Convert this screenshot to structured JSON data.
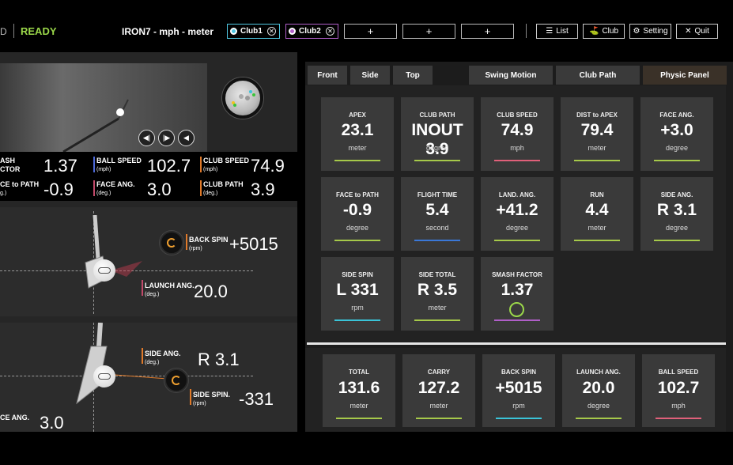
{
  "header": {
    "logo_fragment": "D",
    "status": "READY",
    "title": "IRON7 - mph - meter",
    "club_slots": [
      {
        "label": "Club1",
        "color": "#4ec6e0",
        "removable": true
      },
      {
        "label": "Club2",
        "color": "#b05fc9",
        "removable": true
      },
      {
        "label": "+"
      },
      {
        "label": "+"
      },
      {
        "label": "+"
      }
    ],
    "buttons": [
      {
        "label": "List",
        "icon": "list-icon"
      },
      {
        "label": "Club",
        "icon": "club-icon"
      },
      {
        "label": "Setting",
        "icon": "gear-icon"
      },
      {
        "label": "Quit",
        "icon": "close-icon"
      }
    ]
  },
  "video": {
    "controls": [
      "prev-frame-icon",
      "next-frame-icon",
      "play-back-icon"
    ]
  },
  "summary": {
    "smash": {
      "label": "ASH\nCTOR",
      "line1": "ASH",
      "line2": "CTOR",
      "value": "1.37"
    },
    "ball_speed": {
      "label": "BALL SPEED",
      "unit": "(mph)",
      "value": "102.7"
    },
    "club_speed": {
      "label": "CLUB SPEED",
      "unit": "(mph)",
      "value": "74.9"
    },
    "face_to_path": {
      "label": "CE to PATH",
      "unit": "g.)",
      "value": "-0.9"
    },
    "face_ang": {
      "label": "FACE ANG.",
      "unit": "(deg.)",
      "value": "3.0"
    },
    "club_path": {
      "label": "CLUB PATH",
      "unit": "(deg.)",
      "value": "3.9"
    }
  },
  "side_view": {
    "back_spin": {
      "label": "BACK SPIN",
      "unit": "(rpm)",
      "value": "+5015"
    },
    "launch_ang": {
      "label": "LAUNCH ANG.",
      "unit": "(deg.)",
      "value": "20.0"
    }
  },
  "top_view": {
    "side_ang": {
      "label": "SIDE ANG.",
      "unit": "(deg.)",
      "value": "R 3.1"
    },
    "side_spin": {
      "label": "SIDE SPIN.",
      "unit": "(rpm)",
      "value": "-331"
    },
    "face_ang": {
      "label": "CE ANG.",
      "value": "3.0"
    }
  },
  "tabs": [
    "Front",
    "Side",
    "Top",
    "Swing Motion",
    "Club Path",
    "Physic Panel"
  ],
  "active_tab": "Physic Panel",
  "cards": [
    {
      "label": "APEX",
      "value": "23.1",
      "unit": "meter",
      "color": "#a6c94a"
    },
    {
      "label": "CLUB PATH",
      "value": "INOUT 3.9",
      "unit": "degree",
      "color": "#a6c94a"
    },
    {
      "label": "CLUB SPEED",
      "value": "74.9",
      "unit": "mph",
      "color": "#e0607a"
    },
    {
      "label": "DIST to APEX",
      "value": "79.4",
      "unit": "meter",
      "color": "#a6c94a"
    },
    {
      "label": "FACE ANG.",
      "value": "+3.0",
      "unit": "degree",
      "color": "#a6c94a"
    },
    {
      "label": "FACE to PATH",
      "value": "-0.9",
      "unit": "degree",
      "color": "#a6c94a"
    },
    {
      "label": "FLIGHT TIME",
      "value": "5.4",
      "unit": "second",
      "color": "#3a78d8"
    },
    {
      "label": "LAND. ANG.",
      "value": "+41.2",
      "unit": "degree",
      "color": "#a6c94a"
    },
    {
      "label": "RUN",
      "value": "4.4",
      "unit": "meter",
      "color": "#a6c94a"
    },
    {
      "label": "SIDE ANG.",
      "value": "R 3.1",
      "unit": "degree",
      "color": "#a6c94a"
    },
    {
      "label": "SIDE SPIN",
      "value": "L 331",
      "unit": "rpm",
      "color": "#3ac4d8"
    },
    {
      "label": "SIDE TOTAL",
      "value": "R 3.5",
      "unit": "meter",
      "color": "#a6c94a"
    },
    {
      "label": "SMASH FACTOR",
      "value": "1.37",
      "unit": "",
      "color": "#b05fc9"
    }
  ],
  "bottom_cards": [
    {
      "label": "TOTAL",
      "value": "131.6",
      "unit": "meter",
      "color": "#a6c94a"
    },
    {
      "label": "CARRY",
      "value": "127.2",
      "unit": "meter",
      "color": "#a6c94a"
    },
    {
      "label": "BACK SPIN",
      "value": "+5015",
      "unit": "rpm",
      "color": "#3ac4d8"
    },
    {
      "label": "LAUNCH ANG.",
      "value": "20.0",
      "unit": "degree",
      "color": "#a6c94a"
    },
    {
      "label": "BALL SPEED",
      "value": "102.7",
      "unit": "mph",
      "color": "#e0607a"
    }
  ]
}
